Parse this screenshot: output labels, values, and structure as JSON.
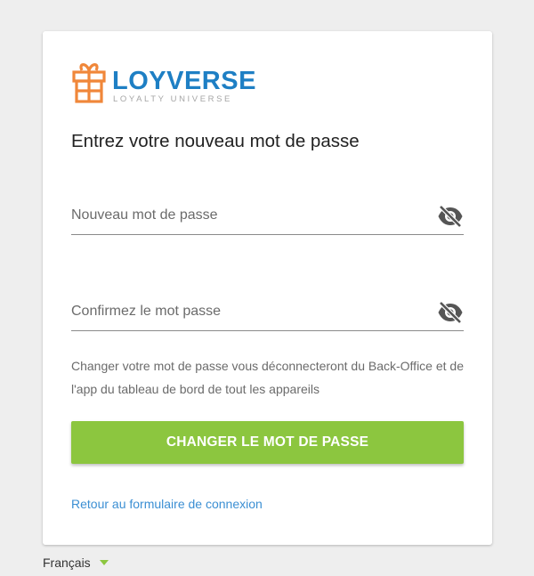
{
  "brand": {
    "name": "LOYVERSE",
    "tagline": "LOYALTY UNIVERSE",
    "logo_icon": "gift-box-icon",
    "colors": {
      "logo_orange": "#f0873a",
      "logo_blue": "#1e7fc4",
      "button_green": "#8cc63f",
      "link_blue": "#3b8fd3"
    }
  },
  "form": {
    "heading": "Entrez votre nouveau mot de passe",
    "new_password": {
      "placeholder": "Nouveau mot de passe",
      "value": "",
      "toggle_icon": "eye-off-icon"
    },
    "confirm_password": {
      "placeholder": "Confirmez le mot passe",
      "value": "",
      "toggle_icon": "eye-off-icon"
    },
    "info_text": "Changer votre mot de passe vous déconnecteront du Back-Office et de l'app du tableau de bord de tout les appareils",
    "submit_label": "CHANGER LE MOT DE PASSE",
    "back_link": "Retour au formulaire de connexion"
  },
  "footer": {
    "language": "Français",
    "language_icon": "caret-down-icon"
  }
}
